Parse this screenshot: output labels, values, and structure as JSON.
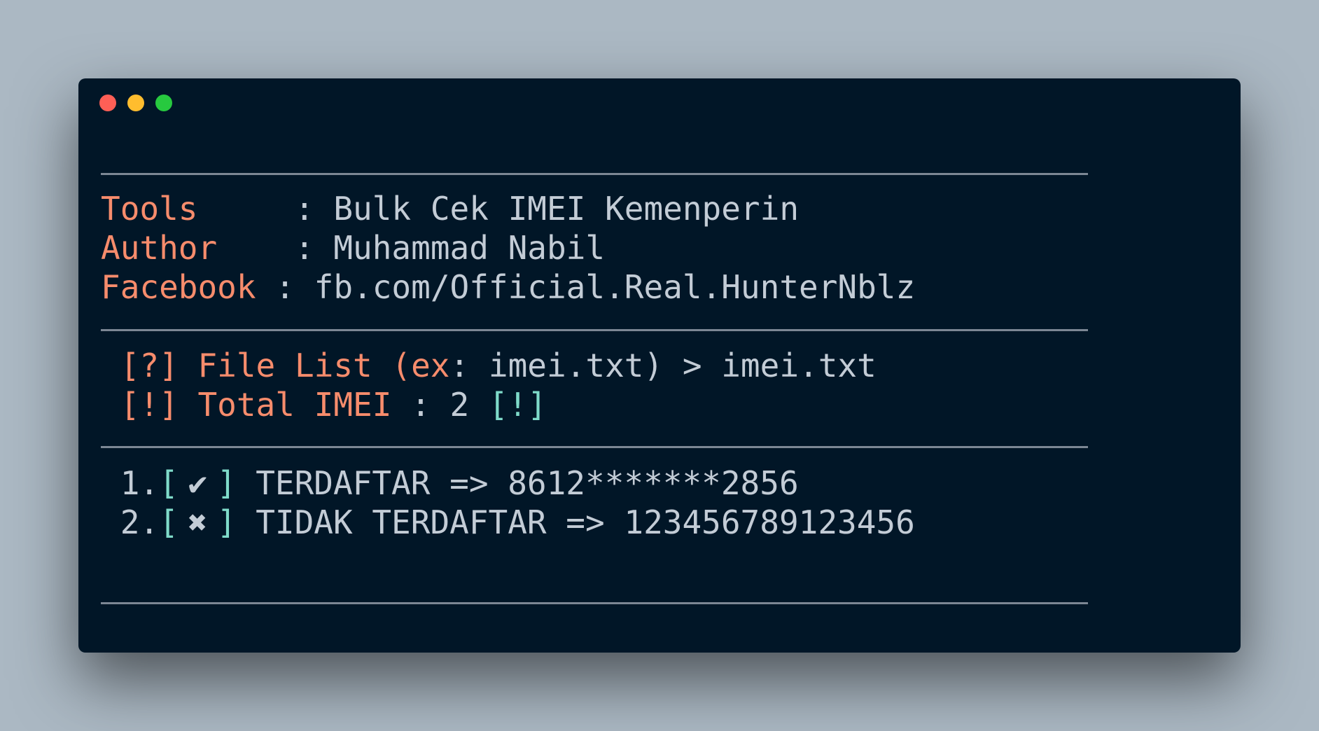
{
  "window": {
    "controls": [
      "close",
      "minimize",
      "zoom"
    ]
  },
  "banner": {
    "tools_label": "Tools    ",
    "tools_sep": " : ",
    "tools_value": "Bulk Cek IMEI Kemenperin",
    "author_label": "Author   ",
    "author_sep": " : ",
    "author_value": "Muhammad Nabil",
    "facebook_label": "Facebook",
    "facebook_sep": " : ",
    "facebook_value": "fb.com/Official.Real.HunterNblz"
  },
  "prompt": {
    "question_tag": " [?] File List (ex",
    "question_colon": ":",
    "question_example": " imei.txt) > ",
    "question_input": "imei.txt",
    "total_tag": " [!] Total IMEI",
    "total_sep": " : ",
    "total_value": "2",
    "total_suffix": " [!]"
  },
  "results": [
    {
      "index": " 1.",
      "bracket_open": "[",
      "mark_icon": "check-icon",
      "mark": "✔",
      "bracket_close": "]",
      "text": " TERDAFTAR => 8612*******2856"
    },
    {
      "index": " 2.",
      "bracket_open": "[",
      "mark_icon": "cross-icon",
      "mark": "✖",
      "bracket_close": "]",
      "text": " TIDAK TERDAFTAR => 123456789123456"
    }
  ],
  "colors": {
    "background": "#abb8c3",
    "terminal": "#011627",
    "label": "#f78c6c",
    "accent": "#7fdbca",
    "text": "#c3ccd6"
  }
}
